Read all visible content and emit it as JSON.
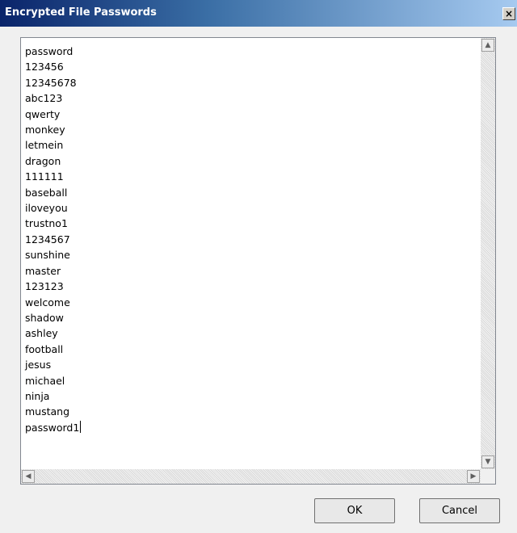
{
  "window": {
    "title": "Encrypted File Passwords",
    "close_glyph": "×"
  },
  "passwords": [
    "password",
    "123456",
    "12345678",
    "abc123",
    "qwerty",
    "monkey",
    "letmein",
    "dragon",
    "111111",
    "baseball",
    "iloveyou",
    "trustno1",
    "1234567",
    "sunshine",
    "master",
    "123123",
    "welcome",
    "shadow",
    "ashley",
    "football",
    "jesus",
    "michael",
    "ninja",
    "mustang",
    "password1"
  ],
  "scrollbars": {
    "up_glyph": "▲",
    "down_glyph": "▼",
    "left_glyph": "◀",
    "right_glyph": "▶"
  },
  "buttons": {
    "ok_label": "OK",
    "cancel_label": "Cancel"
  },
  "colors": {
    "titlebar_start": "#0a246a",
    "titlebar_end": "#a6caf0",
    "dialog_bg": "#f0f0f0"
  }
}
